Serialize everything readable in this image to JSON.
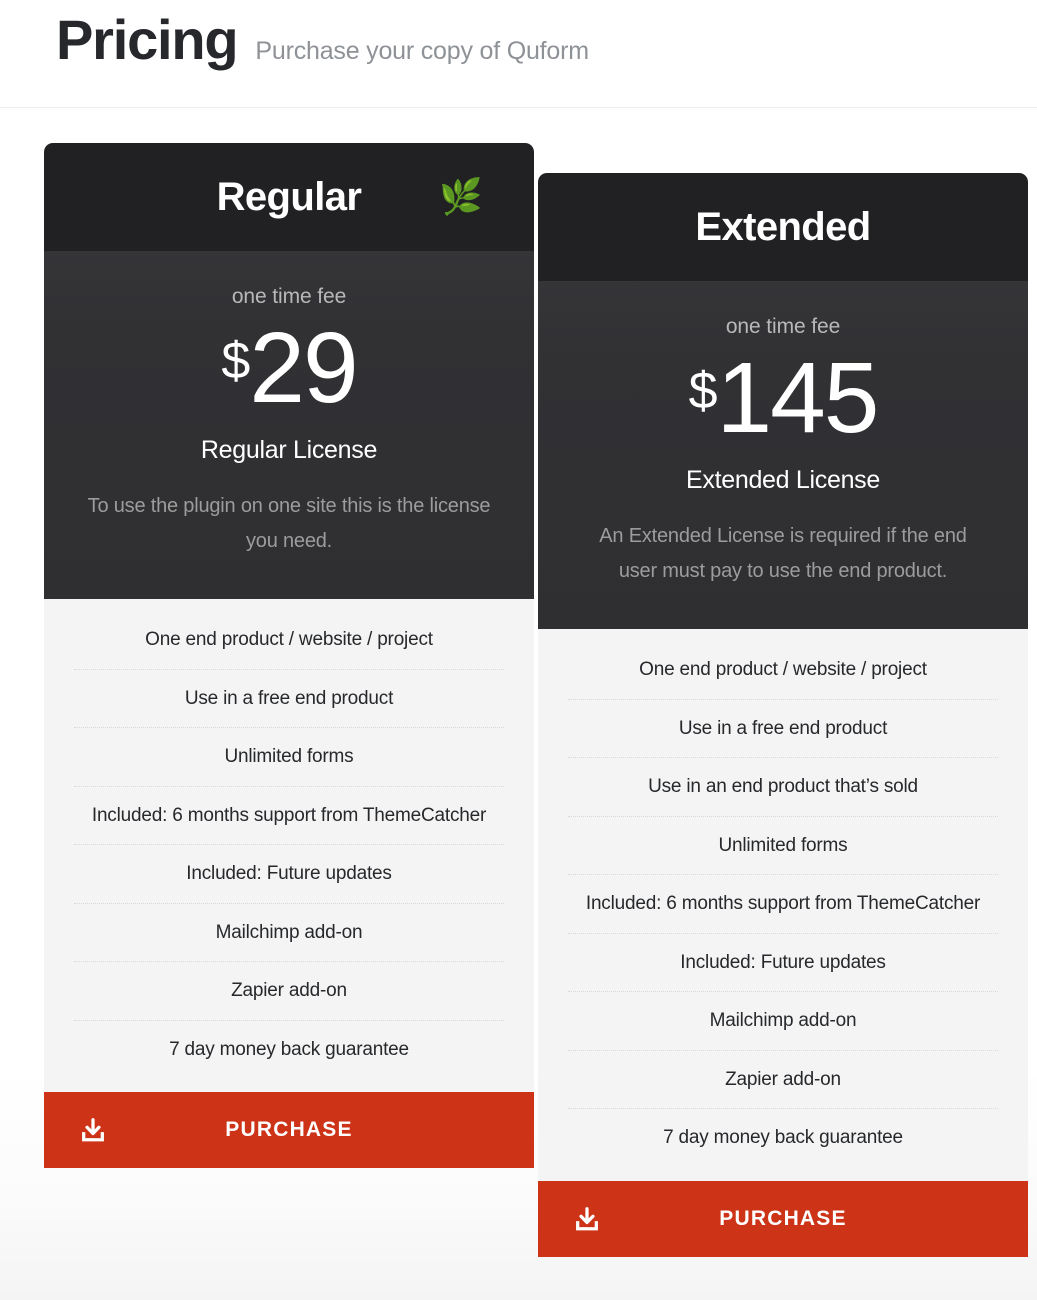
{
  "header": {
    "title": "Pricing",
    "subtitle": "Purchase your copy of Quform"
  },
  "theme": {
    "accent": "#cc3317",
    "card_head_bg": "#212124",
    "card_body_bg": "#313134",
    "features_bg": "#f4f4f4",
    "title_color": "#26282b",
    "laurel_color": "#c9982c"
  },
  "plans": [
    {
      "title": "Regular",
      "badge_icon": "laurel-wreath-icon",
      "fee_label": "one time fee",
      "currency": "$",
      "amount": "29",
      "license_name": "Regular License",
      "description": "To use the plugin on one site this is the license you need.",
      "features": [
        "One end product / website / project",
        "Use in a free end product",
        "Unlimited forms",
        "Included: 6 months support from ThemeCatcher",
        "Included: Future updates",
        "Mailchimp add-on",
        "Zapier add-on",
        "7 day money back guarantee"
      ],
      "button_label": "PURCHASE",
      "button_icon": "download-icon"
    },
    {
      "title": "Extended",
      "badge_icon": "",
      "fee_label": "one time fee",
      "currency": "$",
      "amount": "145",
      "license_name": "Extended License",
      "description": "An Extended License is required if the end user must pay to use the end product.",
      "features": [
        "One end product / website / project",
        "Use in a free end product",
        "Use in an end product that’s sold",
        "Unlimited forms",
        "Included: 6 months support from ThemeCatcher",
        "Included: Future updates",
        "Mailchimp add-on",
        "Zapier add-on",
        "7 day money back guarantee"
      ],
      "button_label": "PURCHASE",
      "button_icon": "download-icon"
    }
  ]
}
